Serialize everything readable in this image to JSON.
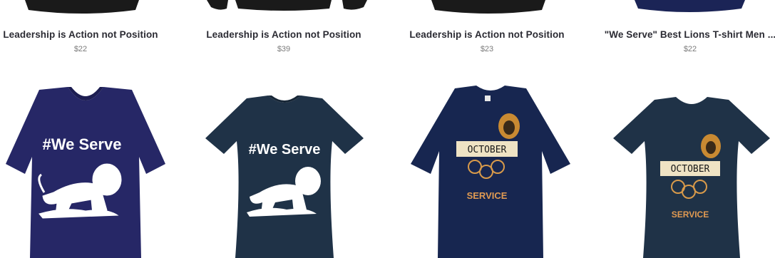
{
  "products_row1": [
    {
      "name": "Leadership is Action not Position",
      "price": "$22",
      "color": "#1a1a1a"
    },
    {
      "name": "Leadership is Action not Position",
      "price": "$39",
      "color": "#1a1a1a"
    },
    {
      "name": "Leadership is Action not Position",
      "price": "$23",
      "color": "#1a1a1a"
    },
    {
      "name": "\"We Serve\" Best Lions T-shirt Men ...",
      "price": "$22",
      "color": "#1b2456"
    }
  ],
  "products_row2": [
    {
      "print_text": "#We Serve",
      "color": "#262766",
      "style": "v-neck"
    },
    {
      "print_text": "#We Serve",
      "color": "#1f3247",
      "style": "womens"
    },
    {
      "print_text": "OCTOBER",
      "print_text_2": "SERVICE",
      "color": "#172650",
      "style": "mens"
    },
    {
      "print_text": "OCTOBER",
      "print_text_2": "SERVICE",
      "color": "#1f3247",
      "style": "womens"
    }
  ]
}
